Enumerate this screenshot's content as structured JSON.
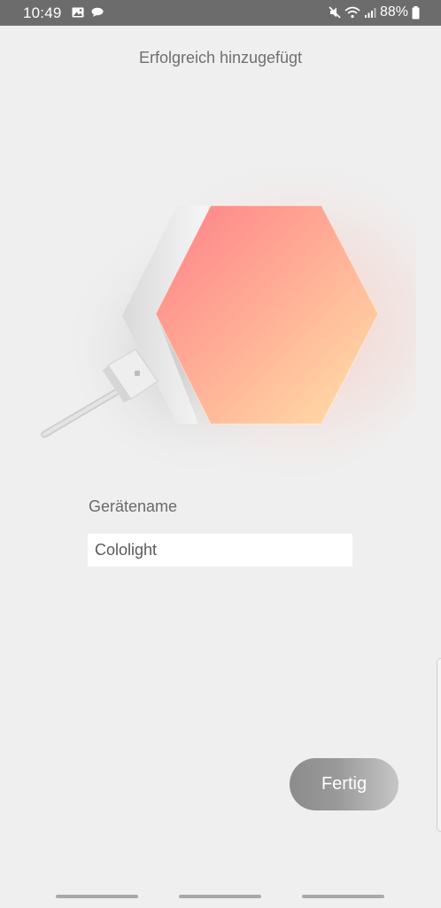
{
  "status_bar": {
    "time": "10:49",
    "battery": "88%",
    "left_icons": [
      "image-notification-icon",
      "message-notification-icon"
    ],
    "right_icons": [
      "mute-icon",
      "wifi-icon",
      "signal-icon",
      "battery-icon"
    ]
  },
  "header": {
    "title": "Erfolgreich hinzugefügt"
  },
  "device": {
    "image_alt": "hexagon-light-panel",
    "gradient_colors": [
      "#ff8a8f",
      "#ffd6a2"
    ]
  },
  "form": {
    "name_label": "Gerätename",
    "name_value": "Cololight"
  },
  "actions": {
    "done_label": "Fertig"
  },
  "nav_bar": {
    "items": [
      "nav-pill-left",
      "nav-pill-center",
      "nav-pill-right"
    ]
  }
}
